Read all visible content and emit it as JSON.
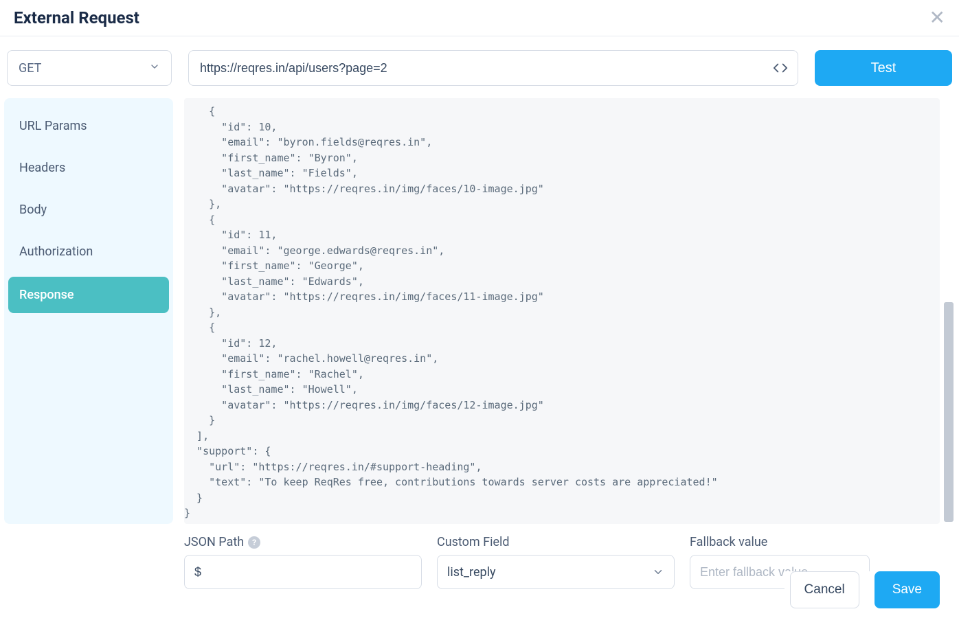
{
  "header": {
    "title": "External Request"
  },
  "request": {
    "method": "GET",
    "url": "https://reqres.in/api/users?page=2",
    "test_label": "Test"
  },
  "sidebar": {
    "items": [
      {
        "label": "URL Params"
      },
      {
        "label": "Headers"
      },
      {
        "label": "Body"
      },
      {
        "label": "Authorization"
      },
      {
        "label": "Response"
      }
    ],
    "active_index": 4
  },
  "response_body": "    {\n      \"id\": 10,\n      \"email\": \"byron.fields@reqres.in\",\n      \"first_name\": \"Byron\",\n      \"last_name\": \"Fields\",\n      \"avatar\": \"https://reqres.in/img/faces/10-image.jpg\"\n    },\n    {\n      \"id\": 11,\n      \"email\": \"george.edwards@reqres.in\",\n      \"first_name\": \"George\",\n      \"last_name\": \"Edwards\",\n      \"avatar\": \"https://reqres.in/img/faces/11-image.jpg\"\n    },\n    {\n      \"id\": 12,\n      \"email\": \"rachel.howell@reqres.in\",\n      \"first_name\": \"Rachel\",\n      \"last_name\": \"Howell\",\n      \"avatar\": \"https://reqres.in/img/faces/12-image.jpg\"\n    }\n  ],\n  \"support\": {\n    \"url\": \"https://reqres.in/#support-heading\",\n    \"text\": \"To keep ReqRes free, contributions towards server costs are appreciated!\"\n  }\n}",
  "fields": {
    "json_path_label": "JSON Path",
    "json_path_value": "$",
    "custom_field_label": "Custom Field",
    "custom_field_value": "list_reply",
    "fallback_label": "Fallback value",
    "fallback_placeholder": "Enter fallback value"
  },
  "footer": {
    "cancel_label": "Cancel",
    "save_label": "Save"
  }
}
